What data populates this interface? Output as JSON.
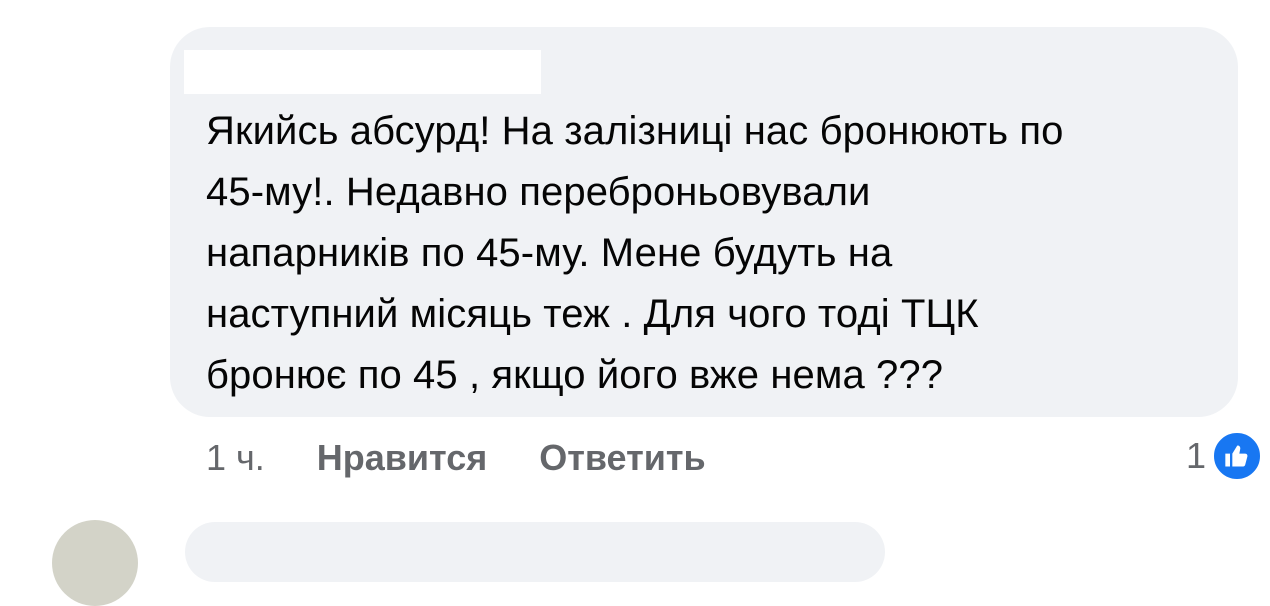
{
  "comment": {
    "text_lines": [
      "Якийсь абсурд! На залізниці нас бронюють по",
      "45-му!. Недавно переброньовували",
      "напарників по 45-му. Мене будуть на",
      "наступний місяць теж . Для чого тоді ТЦК",
      "бронює по 45 , якщо його вже нема ???"
    ],
    "timestamp": "1 ч.",
    "like_label": "Нравится",
    "reply_label": "Ответить",
    "reaction_count": "1",
    "reaction_icon": "thumbs-up-icon"
  },
  "colors": {
    "bubble": "#f0f2f5",
    "text": "#050505",
    "meta": "#65676b",
    "like_blue": "#1877f2"
  }
}
